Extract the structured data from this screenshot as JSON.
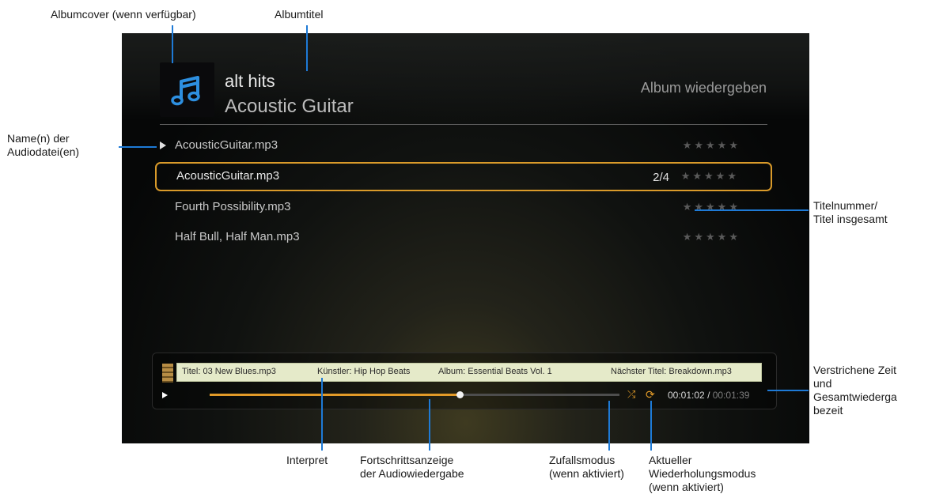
{
  "annotations": {
    "album_cover": "Albumcover (wenn verfügbar)",
    "album_title": "Albumtitel",
    "file_names_l1": "Name(n) der",
    "file_names_l2": "Audiodatei(en)",
    "track_number_l1": "Titelnummer/",
    "track_number_l2": "Titel insgesamt",
    "elapsed_l1": "Verstrichene Zeit",
    "elapsed_l2": "und",
    "elapsed_l3": "Gesamtwiederga",
    "elapsed_l4": "bezeit",
    "artist": "Interpret",
    "progress_l1": "Fortschrittsanzeige",
    "progress_l2": "der Audiowiedergabe",
    "shuffle_l1": "Zufallsmodus",
    "shuffle_l2": "(wenn aktiviert)",
    "repeat_l1": "Aktueller",
    "repeat_l2": "Wiederholungsmodus",
    "repeat_l3": "(wenn aktiviert)"
  },
  "header": {
    "album": "alt hits",
    "subtitle": "Acoustic Guitar",
    "play_album": "Album wiedergeben"
  },
  "tracks": [
    {
      "name": "AcousticGuitar.mp3",
      "stars": "★★★★★",
      "playing": true
    },
    {
      "name": "AcousticGuitar.mp3",
      "stars": "★★★★★",
      "number": "2/4",
      "selected": true
    },
    {
      "name": "Fourth Possibility.mp3",
      "stars": "★★★★★"
    },
    {
      "name": "Half Bull, Half Man.mp3",
      "stars": "★★★★★"
    }
  ],
  "player": {
    "ticker_title": "Titel: 03 New Blues.mp3",
    "ticker_artist": "Künstler: Hip Hop Beats",
    "ticker_album": "Album: Essential Beats Vol. 1",
    "ticker_next": "Nächster Titel: Breakdown.mp3",
    "progress_fraction": 0.61,
    "elapsed": "00:01:02",
    "separator": "/",
    "total": "00:01:39",
    "shuffle_icon": "shuffle-icon",
    "repeat_icon": "repeat-icon"
  },
  "colors": {
    "accent": "#e29a28",
    "callout_line": "#1e7ad6",
    "album_note": "#2d8fe0"
  }
}
